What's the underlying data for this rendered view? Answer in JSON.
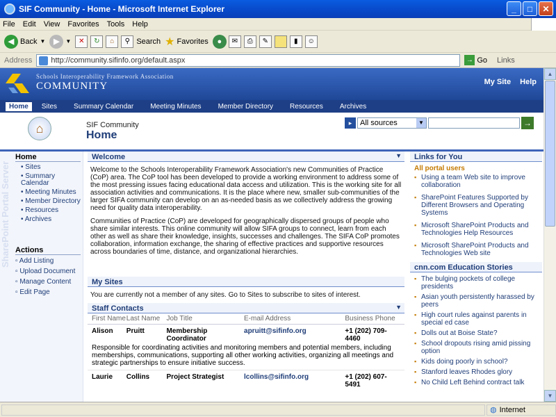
{
  "window": {
    "title": "SIF Community - Home - Microsoft Internet Explorer",
    "minimize": "_",
    "maximize": "□",
    "close": "✕"
  },
  "menu": [
    "File",
    "Edit",
    "View",
    "Favorites",
    "Tools",
    "Help"
  ],
  "toolbar": {
    "back": "Back",
    "search": "Search",
    "favorites": "Favorites"
  },
  "address": {
    "label": "Address",
    "url": "http://community.sifinfo.org/default.aspx",
    "go": "Go",
    "links": "Links"
  },
  "status": {
    "zone": "Internet"
  },
  "site": {
    "logo_small": "Schools Interoperability Framework Association",
    "logo_big": "COMMUNITY",
    "my_site": "My Site",
    "help": "Help",
    "nav": [
      "Home",
      "Sites",
      "Summary Calendar",
      "Meeting Minutes",
      "Member Directory",
      "Resources",
      "Archives"
    ],
    "breadcrumb_small": "SIF Community",
    "page_title": "Home",
    "search_scope": "All sources",
    "watermark": "SharePoint Portal Server"
  },
  "leftnav": {
    "home": "Home",
    "items": [
      "Sites",
      "Summary Calendar",
      "Meeting Minutes",
      "Member Directory",
      "Resources",
      "Archives"
    ],
    "actions_title": "Actions",
    "actions": [
      "Add Listing",
      "Upload Document",
      "Manage Content",
      "Edit Page"
    ]
  },
  "welcome": {
    "title": "Welcome",
    "p1": "Welcome to the Schools Interoperability Framework Association's new Communities of Practice (CoP) area. The CoP tool has been developed to provide a working environment to address some of the most pressing issues facing educational data access and utilization. This is the working site for all association activities and communications. It is the place where new, smaller sub-communities of the larger SIFA community can develop on an as-needed basis as we collectively address the growing need for quality data interoperability.",
    "p2": "Communities of Practice (CoP) are developed for geographically dispersed groups of people who share similar interests. This online community will allow SIFA groups to connect, learn from each other as well as share their knowledge, insights, successes and challenges. The SIFA CoP promotes collaboration, information exchange, the sharing of effective practices and supportive resources across boundaries of time, distance, and organizational hierarchies."
  },
  "mysites": {
    "title": "My Sites",
    "text": "You are currently not a member of any sites. Go to Sites to subscribe to sites of interest."
  },
  "staff": {
    "title": "Staff Contacts",
    "headers": [
      "First Name",
      "Last Name",
      "Job Title",
      "E-mail Address",
      "Business Phone"
    ],
    "rows": [
      {
        "first": "Alison",
        "last": "Pruitt",
        "job": "Membership Coordinator",
        "email": "apruitt@sifinfo.org",
        "phone": "+1 (202) 709-4460",
        "desc": "Responsible for coordinating activities and monitoring members and potential members, including memberships, communications, supporting all other working activities, organizing all meetings and strategic partnerships to ensure initiative success."
      },
      {
        "first": "Laurie",
        "last": "Collins",
        "job": "Project Strategist",
        "email": "lcollins@sifinfo.org",
        "phone": "+1 (202) 607-5491",
        "desc": ""
      }
    ]
  },
  "links": {
    "title": "Links for You",
    "subtitle": "All portal users",
    "items": [
      "Using a team Web site to improve collaboration",
      "SharePoint Features Supported by Different Browsers and Operating Systems",
      "Microsoft SharePoint Products and Technologies Help Resources",
      "Microsoft SharePoint Products and Technologies Web site"
    ]
  },
  "news": {
    "title": "cnn.com Education Stories",
    "items": [
      "The bulging pockets of college presidents",
      "Asian youth persistently harassed by peers",
      "High court rules against parents in special ed case",
      "Dolls out at Boise State?",
      "School dropouts rising amid pissing option",
      "Kids doing poorly in school?",
      "Stanford leaves Rhodes glory",
      "No Child Left Behind contract talk"
    ]
  }
}
